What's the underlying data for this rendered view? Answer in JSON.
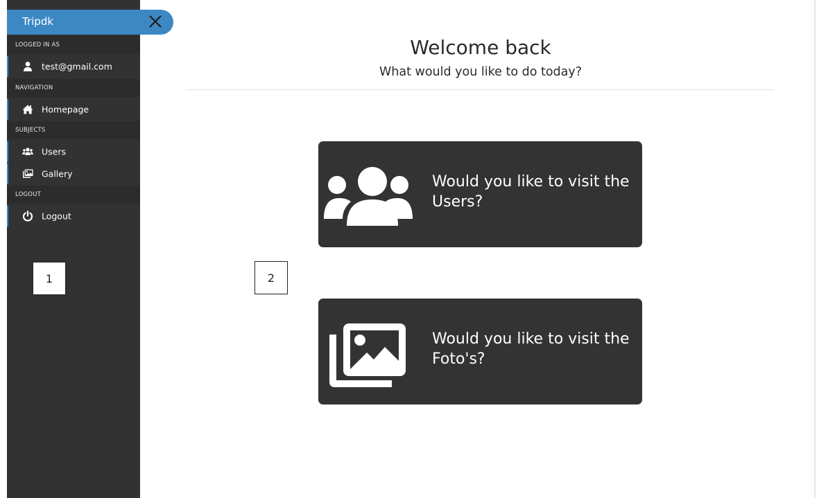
{
  "colors": {
    "sidebar_bg": "#323232",
    "section_bg": "#2c2c2c",
    "brand_bg": "#3d87c3",
    "card_bg": "#333333"
  },
  "sidebar": {
    "brand": "Tripdk",
    "close_icon": "close-icon",
    "sections": [
      {
        "header": "LOGGED IN AS",
        "items": [
          {
            "label": "test@gmail.com",
            "icon": "user-icon"
          }
        ]
      },
      {
        "header": "NAVIGATION",
        "items": [
          {
            "label": "Homepage",
            "icon": "home-icon"
          }
        ]
      },
      {
        "header": "SUBJECTS",
        "items": [
          {
            "label": "Users",
            "icon": "users-icon"
          },
          {
            "label": "Gallery",
            "icon": "gallery-icon"
          }
        ]
      },
      {
        "header": "LOGOUT",
        "items": [
          {
            "label": "Logout",
            "icon": "power-icon"
          }
        ]
      }
    ]
  },
  "annotations": [
    "1",
    "2"
  ],
  "main": {
    "title": "Welcome back",
    "subtitle": "What would you like to do today?",
    "cards": [
      {
        "line1": "Would you like to visit the",
        "line2": "Users?",
        "icon": "users-icon"
      },
      {
        "line1": "Would you like to visit the",
        "line2": "Foto's?",
        "icon": "images-icon"
      }
    ]
  }
}
